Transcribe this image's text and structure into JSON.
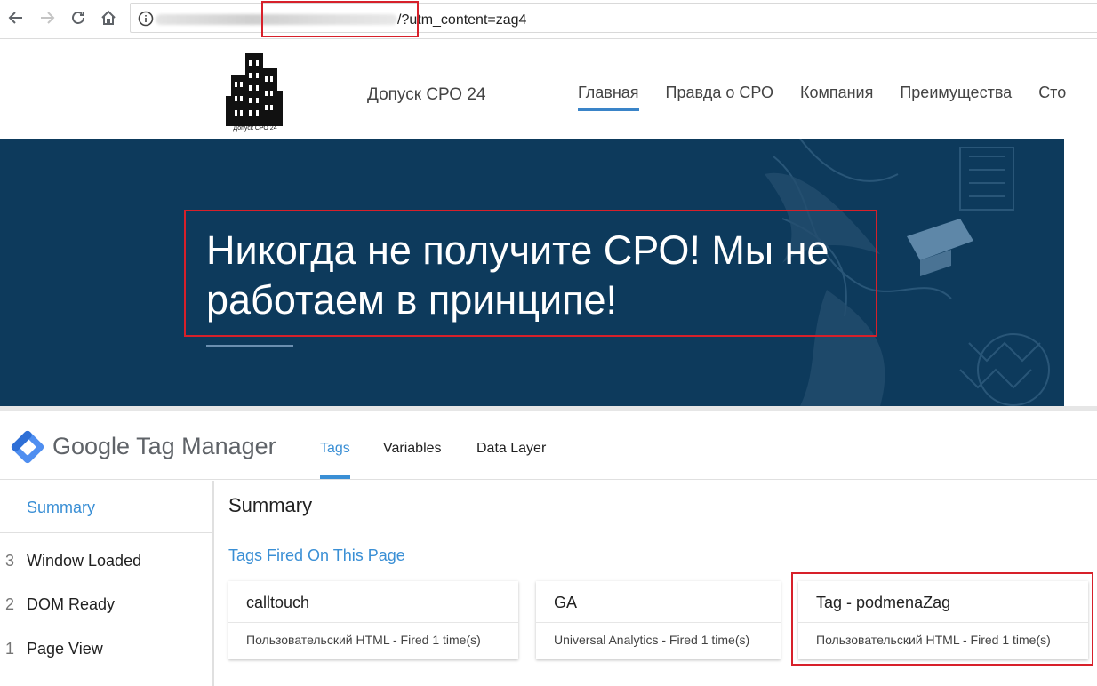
{
  "browser": {
    "url_suffix": "/?utm_content=zag4",
    "icons": [
      "back-arrow-icon",
      "forward-arrow-icon",
      "reload-icon",
      "home-icon",
      "info-icon"
    ]
  },
  "site": {
    "logo_caption": "Допуск СРО 24",
    "brand": "Допуск СРО 24",
    "nav": [
      {
        "label": "Главная",
        "active": true
      },
      {
        "label": "Правда о СРО"
      },
      {
        "label": "Компания"
      },
      {
        "label": "Преимущества"
      },
      {
        "label": "Сто"
      }
    ],
    "hero_title": "Никогда не получите СРО! Мы не работаем в принципе!"
  },
  "gtm": {
    "brand": "Google Tag Manager",
    "tabs": [
      {
        "label": "Tags",
        "active": true
      },
      {
        "label": "Variables"
      },
      {
        "label": "Data Layer"
      }
    ],
    "sidebar": {
      "summary": "Summary",
      "events": [
        {
          "num": "3",
          "label": "Window Loaded"
        },
        {
          "num": "2",
          "label": "DOM Ready"
        },
        {
          "num": "1",
          "label": "Page View"
        }
      ]
    },
    "main": {
      "title": "Summary",
      "subtitle": "Tags Fired On This Page",
      "cards": [
        {
          "name": "calltouch",
          "desc": "Пользовательский HTML - Fired 1 time(s)"
        },
        {
          "name": "GA",
          "desc": "Universal Analytics - Fired 1 time(s)"
        },
        {
          "name": "Tag - podmenaZag",
          "desc": "Пользовательский HTML - Fired 1 time(s)"
        }
      ]
    }
  },
  "colors": {
    "accent_blue": "#3a8fd5",
    "hero_bg": "#0d3a5c",
    "highlight_red": "#d7202a"
  }
}
